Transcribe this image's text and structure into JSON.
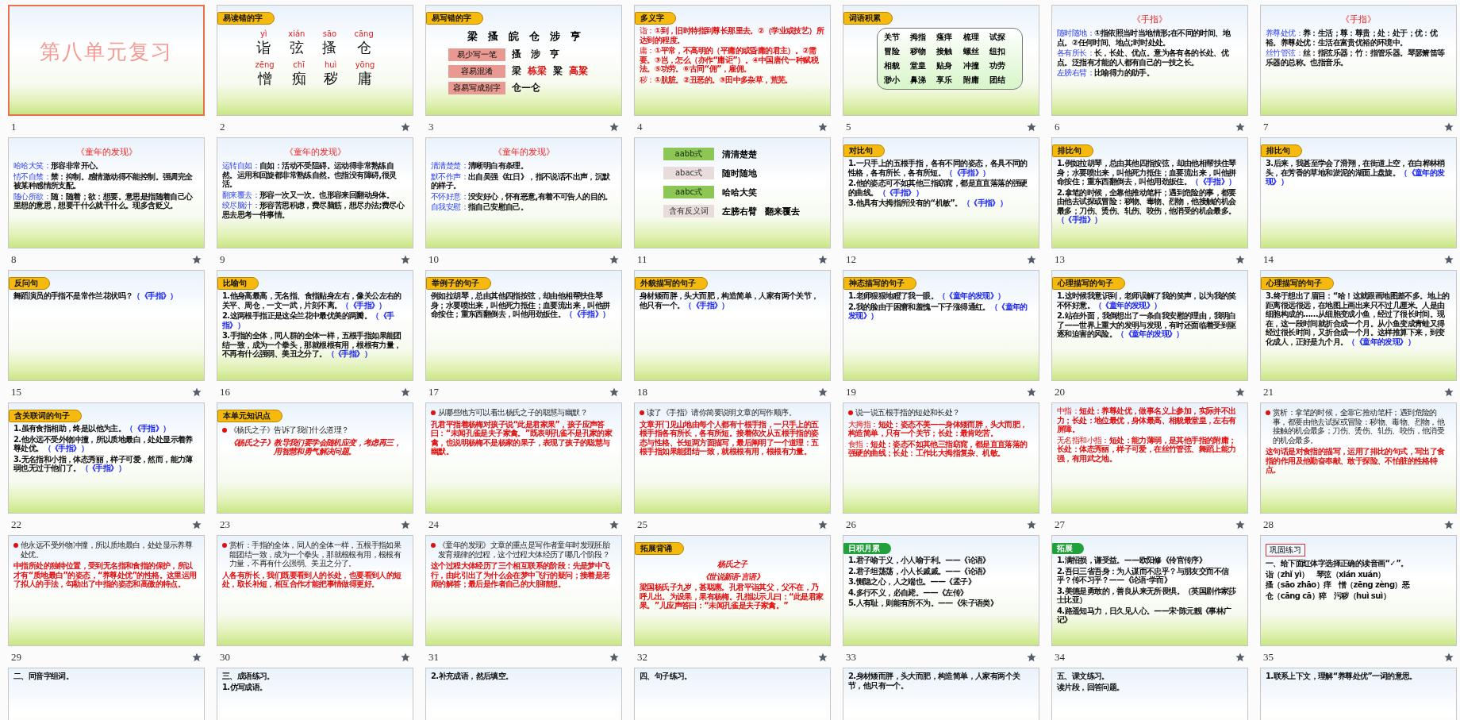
{
  "slides": [
    {
      "number": "1",
      "selected": true,
      "transition": false,
      "blocks": [
        {
          "kind": "cover",
          "text": "第八单元复习"
        }
      ]
    },
    {
      "number": "2",
      "selected": false,
      "transition": true,
      "tag": {
        "text": "易读错的字",
        "kind": "yellow"
      },
      "blocks": [
        {
          "kind": "pinyin",
          "items": [
            {
              "pinyin": "yì",
              "char": "诣"
            },
            {
              "pinyin": "xián",
              "char": "弦"
            },
            {
              "pinyin": "sāo",
              "char": "搔"
            },
            {
              "pinyin": "cāng",
              "char": "仓"
            }
          ]
        },
        {
          "kind": "pinyin",
          "items": [
            {
              "pinyin": "zēng",
              "char": "憎"
            },
            {
              "pinyin": "chī",
              "char": "痴"
            },
            {
              "pinyin": "huì",
              "char": "秽"
            },
            {
              "pinyin": "yōng",
              "char": "庸"
            }
          ]
        }
      ]
    },
    {
      "number": "3",
      "selected": false,
      "transition": true,
      "tag": {
        "text": "易写错的字",
        "kind": "yellow"
      },
      "blocks": [
        {
          "kind": "chars",
          "text": "梁　搔　皖　仓　涉　亨"
        },
        {
          "kind": "labeled",
          "label": "易少写一笔",
          "parts": [
            {
              "text": "搔　涉　亨",
              "highlighted": false
            }
          ]
        },
        {
          "kind": "labeled",
          "label": "容易混淆",
          "parts": [
            {
              "text": "梁",
              "highlighted": false
            },
            {
              "text": "栋梁",
              "highlighted": true
            },
            {
              "text": "粱",
              "highlighted": false
            },
            {
              "text": "高粱",
              "highlighted": true
            }
          ]
        },
        {
          "kind": "labeled",
          "label": "容易写成别字",
          "parts": [
            {
              "text": "仓—仑",
              "highlighted": false
            }
          ]
        }
      ]
    },
    {
      "number": "4",
      "selected": false,
      "transition": true,
      "tag": {
        "text": "多义字",
        "kind": "yellow"
      },
      "blocks": [
        {
          "kind": "term",
          "term": "诣：",
          "highlighted": true,
          "text": "①到，旧时特指到尊长那里去。②（学业或技艺）所达到的程度。"
        },
        {
          "kind": "term",
          "term": "庸：",
          "highlighted": true,
          "text": "①平常，不高明的（平庸的或昏庸的君主）。②需要。③岂，怎么（亦作“庸讵”）。④中国唐代一种赋税法。⑤功劳。⑥古同“佣”，雇佣。"
        },
        {
          "kind": "term",
          "term": "秽：",
          "highlighted": true,
          "text": "①肮脏。②丑恶的。③田中多杂草，荒芜。"
        }
      ]
    },
    {
      "number": "5",
      "selected": false,
      "transition": true,
      "tag": {
        "text": "词语积累",
        "kind": "yellow"
      },
      "blocks": [
        {
          "kind": "grid",
          "words": [
            "关节",
            "拇指",
            "瘙痒",
            "梳理",
            "试探",
            "冒险",
            "秽物",
            "接触",
            "螺丝",
            "纽扣",
            "相貌",
            "堂皇",
            "贴身",
            "冲撞",
            "功劳",
            "渺小",
            "鼻涕",
            "享乐",
            "附庸",
            "团结"
          ]
        }
      ]
    },
    {
      "number": "6",
      "selected": false,
      "transition": true,
      "title": "《手指》",
      "blocks": [
        {
          "kind": "term",
          "term": "随时随地：",
          "highlighted": false,
          "text": "①指依照当时当地情形;在不同的时间、地点。②任何时间、地点;时时处处。"
        },
        {
          "kind": "term",
          "term": "各有所长：",
          "highlighted": false,
          "text": "长，长处、优点。意为各有各的长处、优点。泛指有才能的人都有自己的一技之长。"
        },
        {
          "kind": "term",
          "term": "左膀右臂：",
          "highlighted": false,
          "text": "比喻得力的助手。"
        }
      ]
    },
    {
      "number": "7",
      "selected": false,
      "transition": true,
      "title": "《手指》",
      "blocks": [
        {
          "kind": "term",
          "term": "养尊处优：",
          "highlighted": false,
          "text": "养：生活；尊：尊贵；处：处于；优：优裕。养尊处优：生活在富贵优裕的环境中。"
        },
        {
          "kind": "term",
          "term": "丝竹管弦：",
          "highlighted": false,
          "text": "丝：指弦乐器；竹：指管乐器。琴瑟箫笛等乐器的总称。也指音乐。"
        }
      ]
    },
    {
      "number": "8",
      "selected": false,
      "transition": true,
      "title": "《童年的发现》",
      "blocks": [
        {
          "kind": "term",
          "term": "哈哈大笑：",
          "highlighted": false,
          "text": "形容非常开心。"
        },
        {
          "kind": "term",
          "term": "情不自禁：",
          "highlighted": false,
          "text": "禁：抑制。感情激动得不能控制。强调完全被某种感情所支配。"
        },
        {
          "kind": "term",
          "term": "随心所欲：",
          "highlighted": false,
          "text": "随：随着；欲：想要。意思是指随着自己心里想的意思，想要干什么就干什么。现多含贬义。"
        }
      ]
    },
    {
      "number": "9",
      "selected": false,
      "transition": true,
      "title": "《童年的发现》",
      "blocks": [
        {
          "kind": "term",
          "term": "运转自如：",
          "highlighted": false,
          "text": "自如：活动不受阻碍。运动得非常熟练自然。运用和回旋都非常熟练自然。也指没有障碍,很灵活。"
        },
        {
          "kind": "term",
          "term": "翻来覆去：",
          "highlighted": false,
          "text": "形容一次又一次。也形容来回翻动身体。"
        },
        {
          "kind": "term",
          "term": "绞尽脑汁：",
          "highlighted": false,
          "text": "形容苦思积虑，费尽脑筋，想尽办法;费尽心思去思考一件事情。"
        }
      ]
    },
    {
      "number": "10",
      "selected": false,
      "transition": true,
      "title": "《童年的发现》",
      "blocks": [
        {
          "kind": "term",
          "term": "清清楚楚：",
          "highlighted": false,
          "text": "清晰明白有条理。"
        },
        {
          "kind": "term",
          "term": "默不作声：",
          "highlighted": false,
          "text": "出自吴强《红日》，指不说话不出声，沉默的样子。"
        },
        {
          "kind": "term",
          "term": "不怀好意：",
          "highlighted": false,
          "text": "没安好心，怀有恶意,有着不可告人的目的。"
        },
        {
          "kind": "term",
          "term": "自我安慰：",
          "highlighted": false,
          "text": "指自己安慰自己。"
        }
      ]
    },
    {
      "number": "11",
      "selected": false,
      "transition": true,
      "blocks": [
        {
          "kind": "chip",
          "label": "aabb式",
          "words": [
            "清清楚楚"
          ]
        },
        {
          "kind": "chip",
          "label": "abac式",
          "words": [
            "随时随地"
          ]
        },
        {
          "kind": "chip",
          "label": "aabc式",
          "words": [
            "哈哈大笑"
          ]
        },
        {
          "kind": "chip",
          "label": "含有反义词",
          "words": [
            "左膀右臂",
            "翻来覆去"
          ]
        }
      ]
    },
    {
      "number": "12",
      "selected": false,
      "transition": true,
      "tag": {
        "text": "对比句",
        "kind": "yellow"
      },
      "blocks": [
        {
          "kind": "para",
          "highlighted": false,
          "text": "1.一只手上的五根手指，各有不同的姿态，各具不同的性格，各有所长，各有所短。",
          "source": "（《手指》）"
        },
        {
          "kind": "para",
          "highlighted": false,
          "text": "2.他的姿态可不如其他三指窈窕，都是直直落落的强硬的曲线。",
          "source": "（《手指》）"
        },
        {
          "kind": "para",
          "highlighted": false,
          "text": "3.他具有大拇指所没有的“机敏”。",
          "source": "（《手指》）"
        }
      ]
    },
    {
      "number": "13",
      "selected": false,
      "transition": true,
      "tag": {
        "text": "排比句",
        "kind": "yellow"
      },
      "blocks": [
        {
          "kind": "para",
          "highlighted": false,
          "text": "1.例如拉胡琴，总由其他四指按弦，却由他相帮扶住琴身；水要喷出来，叫他死力抵住；血要流出来，叫他拼命按住；重东西翻倒去，叫他用劲扳住。",
          "source": "（《手指》）"
        },
        {
          "kind": "para",
          "highlighted": false,
          "text": "2.拿笔的时候，全靠他推动笔杆；遇到危险的事，都要由他去试探或冒险：秽物、毒物、烈物，他接触的机会最多；刀伤、烫伤、轧伤、咬伤，他消受的机会最多。",
          "source": "（《手指》）"
        }
      ]
    },
    {
      "number": "14",
      "selected": false,
      "transition": true,
      "tag": {
        "text": "排比句",
        "kind": "yellow"
      },
      "blocks": [
        {
          "kind": "para",
          "highlighted": false,
          "text": "3.后来，我甚至学会了滑翔，在街道上空，在白桦林梢头，在芳香的草地和淤泥的湖面上盘旋。",
          "source": "（《童年的发现》）"
        }
      ]
    },
    {
      "number": "15",
      "selected": false,
      "transition": true,
      "tag": {
        "text": "反问句",
        "kind": "yellow"
      },
      "blocks": [
        {
          "kind": "para",
          "highlighted": false,
          "text": "舞蹈演员的手指不是常作兰花状吗？",
          "source": "（《手指》）"
        }
      ]
    },
    {
      "number": "16",
      "selected": false,
      "transition": true,
      "tag": {
        "text": "比喻句",
        "kind": "yellow"
      },
      "blocks": [
        {
          "kind": "para",
          "highlighted": false,
          "text": "1.他身高最高，无名指、食指贴身左右，像关公左右的关平、周仓，一文一武，片刻不离。",
          "source": "（《手指》）"
        },
        {
          "kind": "para",
          "highlighted": false,
          "text": "2.这两根手指正是这朵兰花中最优美的两瓣。",
          "source": "（《手指》）"
        },
        {
          "kind": "para",
          "highlighted": false,
          "text": "3.手指的全体，同人群的全体一样，五根手指如果能团结一致，成为一个拳头，那就根根有用，根根有力量，不再有什么强弱、美丑之分了。",
          "source": "（《手指》）"
        }
      ]
    },
    {
      "number": "17",
      "selected": false,
      "transition": true,
      "tag": {
        "text": "举例子的句子",
        "kind": "yellow"
      },
      "blocks": [
        {
          "kind": "para",
          "highlighted": false,
          "text": "例如拉胡琴，总由其他四指按弦，却由他相帮扶住琴身；水要喷出来，叫他死力抵住；血要流出来，叫他拼命按住；重东西翻倒去，叫他用劲扳住。",
          "source": "（《手指》）"
        }
      ]
    },
    {
      "number": "18",
      "selected": false,
      "transition": true,
      "tag": {
        "text": "外貌描写的句子",
        "kind": "yellow"
      },
      "blocks": [
        {
          "kind": "para",
          "highlighted": false,
          "text": "身材矮而胖，头大而肥，构造简单，人家有两个关节，他只有一个。",
          "source": "（《手指》）"
        }
      ]
    },
    {
      "number": "19",
      "selected": false,
      "transition": true,
      "tag": {
        "text": "神态描写的句子",
        "kind": "yellow"
      },
      "blocks": [
        {
          "kind": "para",
          "highlighted": false,
          "text": "1.老师狠狠地瞪了我一眼。",
          "source": "（《童年的发现》）"
        },
        {
          "kind": "para",
          "highlighted": false,
          "text": "2.我的脸由于困窘和羞愧一下子涨得通红。",
          "source": "（《童年的发现》）"
        }
      ]
    },
    {
      "number": "20",
      "selected": false,
      "transition": true,
      "tag": {
        "text": "心理描写的句子",
        "kind": "yellow"
      },
      "blocks": [
        {
          "kind": "para",
          "highlighted": false,
          "text": "1.这时候我意识到，老师误解了我的笑声，以为我的笑不怀好意。",
          "source": "（《童年的发现》）"
        },
        {
          "kind": "para",
          "highlighted": false,
          "text": "2.站在外面，我倒想出了一条自我安慰的理由，我明白了——世界上重大的发明与发现，有时还面临着受到驱逐和迫害的风险。",
          "source": "（《童年的发现》）"
        }
      ]
    },
    {
      "number": "21",
      "selected": false,
      "transition": true,
      "tag": {
        "text": "心理描写的句子",
        "kind": "yellow"
      },
      "blocks": [
        {
          "kind": "para",
          "highlighted": false,
          "text": "3.终于想出了眉目：“哈！这就跟画地图差不多。地上的距离很远很远，在地图上画出来只不过几厘米。人是由细胞构成的……从细胞变成小鱼，经过了很长时间。现在，这一段时间就折合成一个月。从小鱼变成青蛙又得经过很长时间，又折合成一个月。这样推算下来，到变化成人，正好是九个月。",
          "source": "（《童年的发现》）"
        }
      ]
    },
    {
      "number": "22",
      "selected": false,
      "transition": true,
      "tag": {
        "text": "含关联词的句子",
        "kind": "yellow"
      },
      "blocks": [
        {
          "kind": "para",
          "highlighted": false,
          "text": "1.虽有食指相助，终是以他为主。",
          "source": "（《手指》）"
        },
        {
          "kind": "para",
          "highlighted": false,
          "text": "2.他永远不受外物冲撞，所以质地最白，处处显示着养尊处优。",
          "source": "（《手指》）"
        },
        {
          "kind": "para",
          "highlighted": false,
          "text": "3.无名指和小指，体态秀丽，样子可爱，然而，能力薄弱也无过于他们了。",
          "source": "（《手指》）"
        }
      ]
    },
    {
      "number": "23",
      "selected": false,
      "transition": true,
      "tag": {
        "text": "本单元知识点",
        "kind": "yellow"
      },
      "blocks": [
        {
          "kind": "bullet",
          "text": "《杨氏之子》告诉了我们什么道理？"
        },
        {
          "kind": "center",
          "text": "《杨氏之子》教导我们要学会随机应变，考虑再三，用智慧和勇气解决问题。"
        }
      ]
    },
    {
      "number": "24",
      "selected": false,
      "transition": true,
      "blocks": [
        {
          "kind": "bullet",
          "text": "从哪些地方可以看出杨氏之子的聪慧与幽默？"
        },
        {
          "kind": "para",
          "highlighted": true,
          "text": "孔君平指着杨梅对孩子说“此是君家果”，孩子应声答曰：“未闻孔雀是夫子家禽。”既表明孔雀不是孔家的家禽，也说明杨梅不是杨家的果子，表现了孩子的聪慧与幽默。"
        }
      ]
    },
    {
      "number": "25",
      "selected": false,
      "transition": true,
      "blocks": [
        {
          "kind": "bullet",
          "text": "读了《手指》请你简要说明文章的写作顺序。"
        },
        {
          "kind": "para",
          "highlighted": true,
          "text": "文章开门见山地由每个人都有十根手指，一只手上的五根手指各有所长，各有所短。接着依次从五根手指的姿态与性格、长短两方面描写，最后阐明了一个道理：五根手指如果能团结一致，就根根有用，根根有力量。"
        }
      ]
    },
    {
      "number": "26",
      "selected": false,
      "transition": true,
      "blocks": [
        {
          "kind": "bullet",
          "text": "说一说五根手指的短处和长处？"
        },
        {
          "kind": "term",
          "term": "大拇指：",
          "highlighted": true,
          "text": "短处：姿态不美——身体矮而胖，头大而肥，构造简单，只有一个关节；长处：最肯吃苦。"
        },
        {
          "kind": "term",
          "term": "食指：",
          "highlighted": true,
          "text": "短处：姿态不如其他三指窈窕，都是直直落落的强硬的曲线；长处：工作比大拇指复杂、机敏。"
        }
      ]
    },
    {
      "number": "27",
      "selected": false,
      "transition": true,
      "blocks": [
        {
          "kind": "term",
          "term": "中指：",
          "highlighted": true,
          "text": "短处：养尊处优，做事名义上参加，实际并不出力；长处：地位最优，身体最高、相貌最堂皇，左右有屏障。"
        },
        {
          "kind": "term",
          "term": "无名指和小指：",
          "highlighted": true,
          "text": "短处：能力薄弱，是其他手指的附庸；长处：体态秀丽，样子可爱，在丝竹管弦、舞蹈上能力强，有用武之地。"
        }
      ]
    },
    {
      "number": "28",
      "selected": false,
      "transition": true,
      "blocks": [
        {
          "kind": "bullet",
          "text": "赏析：拿笔的时候，全靠它推动笔杆；遇到危险的事，都要由他去试探或冒险：秽物、毒物、烈物，他接触的机会最多；刀伤、烫伤、轧伤、咬伤，他消受的机会最多。"
        },
        {
          "kind": "para",
          "highlighted": true,
          "text": "这句话是对食指的描写，运用了排比的句式，写出了食指的作用及他勤奋奉献、敢于探险、不怕脏的性格特点。"
        }
      ]
    },
    {
      "number": "29",
      "selected": false,
      "transition": true,
      "blocks": [
        {
          "kind": "bullet",
          "text": "他永远不受外物冲撞，所以质地最白，处处显示养尊处优。"
        },
        {
          "kind": "para",
          "highlighted": true,
          "text": "中指所处的独特位置，受到无名指和食指的保护，所以才有“质地最白”的姿态，“养尊处优”的性格。这里运用了拟人的手法，勾勒出了中指的姿态和高傲的特点。"
        }
      ]
    },
    {
      "number": "30",
      "selected": false,
      "transition": true,
      "blocks": [
        {
          "kind": "bullet",
          "text": "赏析：手指的全体，同人的全体一样，五根手指如果能团结一致，成为一个拳头，那就根根有用，根根有力量，不再有什么强弱、美丑之分了。"
        },
        {
          "kind": "para",
          "highlighted": true,
          "text": "人各有所长，我们既要看到人的长处，也要看到人的短处，取长补短，相互合作才能把事情做得更好。"
        }
      ]
    },
    {
      "number": "31",
      "selected": false,
      "transition": true,
      "blocks": [
        {
          "kind": "bullet",
          "text": "《童年的发现》文章的重点是写作者童年时发现胚胎发育规律的过程，这个过程大体经历了哪几个阶段？"
        },
        {
          "kind": "para",
          "highlighted": true,
          "text": "这个过程大体经历了三个相互联系的阶段：先是梦中飞行，由此引出了为什么会在梦中飞行的疑问；接着是老师的解答；最后是作者自己的大胆猜想。"
        }
      ]
    },
    {
      "number": "32",
      "selected": false,
      "transition": true,
      "tag": {
        "text": "拓展背诵",
        "kind": "yellow"
      },
      "blocks": [
        {
          "kind": "center",
          "text": "杨氏之子"
        },
        {
          "kind": "center",
          "text": "《世说新语·言语》"
        },
        {
          "kind": "para",
          "highlighted": true,
          "text": "梁国杨氏子九岁，甚聪惠。孔君平诣其父，父不在，乃呼儿出。为设果，果有杨梅。孔指以示儿曰：“此是君家果。”儿应声答曰：“未闻孔雀是夫子家禽。”"
        }
      ]
    },
    {
      "number": "33",
      "selected": false,
      "transition": true,
      "tag": {
        "text": "日积月累",
        "kind": "green"
      },
      "blocks": [
        {
          "kind": "para",
          "highlighted": false,
          "text": "1.君子喻于义，小人喻于利。——《论语》"
        },
        {
          "kind": "para",
          "highlighted": false,
          "text": "2.君子坦荡荡，小人长戚戚。——《论语》"
        },
        {
          "kind": "para",
          "highlighted": false,
          "text": "3.恻隐之心，人之端也。——《孟子》"
        },
        {
          "kind": "para",
          "highlighted": false,
          "text": "4.多行不义，必自毙。——《左传》"
        },
        {
          "kind": "para",
          "highlighted": false,
          "text": "5.人有耻，则能有所不为。——《朱子语类》"
        }
      ]
    },
    {
      "number": "34",
      "selected": false,
      "transition": true,
      "tag": {
        "text": "拓展",
        "kind": "green"
      },
      "blocks": [
        {
          "kind": "para",
          "highlighted": false,
          "text": "1.满招损，谦受益。——欧阳修《伶官传序》"
        },
        {
          "kind": "para",
          "highlighted": false,
          "text": "2.吾日三省吾身：为人谋而不忠乎？与朋友交而不信乎？传不习乎？——《论语·学而》"
        },
        {
          "kind": "para",
          "highlighted": false,
          "text": "3.美德是勇敢的，善良从来无所畏惧。（英国剧作家莎士比亚）"
        },
        {
          "kind": "para",
          "highlighted": false,
          "text": "4.路遥知马力，日久见人心。——宋·陈元靓《事林广记》"
        }
      ]
    },
    {
      "number": "35",
      "selected": false,
      "transition": true,
      "blocks": [
        {
          "kind": "boxed",
          "text": "巩固练习"
        },
        {
          "kind": "para",
          "highlighted": false,
          "text": "一、给下面红体字选择正确的读音画“✓”。"
        },
        {
          "kind": "para",
          "highlighted": false,
          "text": "诣（zhǐ yì）　琴弦（xián xuán）"
        },
        {
          "kind": "para",
          "highlighted": false,
          "text": "搔（sāo zhāo）痒　憎（zēng zèng）恶"
        },
        {
          "kind": "para",
          "highlighted": false,
          "text": "仓（cāng cā）猝　污秽（huì suì）"
        }
      ]
    },
    {
      "selected": false,
      "blocks": [
        {
          "kind": "para",
          "highlighted": false,
          "text": "二、同音字组词。"
        }
      ]
    },
    {
      "selected": false,
      "blocks": [
        {
          "kind": "para",
          "highlighted": false,
          "text": "三、成语练习。"
        },
        {
          "kind": "para",
          "highlighted": false,
          "text": "1.仿写成语。"
        }
      ]
    },
    {
      "selected": false,
      "blocks": [
        {
          "kind": "para",
          "highlighted": false,
          "text": "2.补充成语，然后填空。"
        }
      ]
    },
    {
      "selected": false,
      "blocks": [
        {
          "kind": "para",
          "highlighted": false,
          "text": "四、句子练习。"
        }
      ]
    },
    {
      "selected": false,
      "blocks": [
        {
          "kind": "para",
          "highlighted": false,
          "text": "2.身材矮而胖，头大而肥，构造简单，人家有两个关节，他只有一个。"
        }
      ]
    },
    {
      "selected": false,
      "blocks": [
        {
          "kind": "para",
          "highlighted": false,
          "text": "五、课文练习。"
        },
        {
          "kind": "para",
          "highlighted": false,
          "text": "读片段，回答问题。"
        }
      ]
    },
    {
      "selected": false,
      "blocks": [
        {
          "kind": "para",
          "highlighted": false,
          "text": "1.联系上下文，理解“养尊处优”一词的意思。"
        }
      ]
    }
  ]
}
